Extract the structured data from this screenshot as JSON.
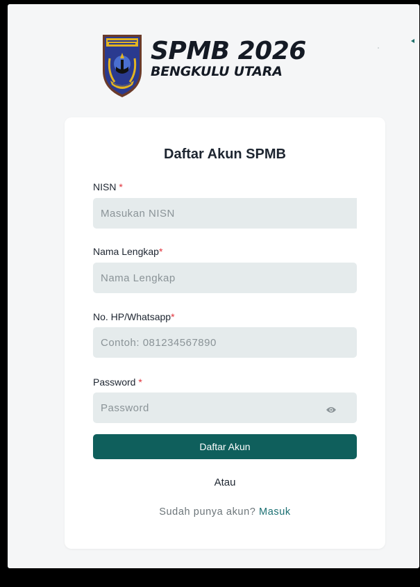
{
  "brand": {
    "title": "SPMB 2026",
    "subtitle": "BENGKULU UTARA",
    "crest_icon": "kabupaten-crest-icon",
    "crest_colors": {
      "shield": "#2a3a8f",
      "gold": "#e3b422",
      "border": "#6b3b2a"
    }
  },
  "form": {
    "title": "Daftar Akun SPMB",
    "fields": [
      {
        "label": "NISN ",
        "required_mark": "*",
        "placeholder": "Masukan NISN",
        "value": ""
      },
      {
        "label": "Nama Lengkap",
        "required_mark": "*",
        "placeholder": "Nama Lengkap",
        "value": ""
      },
      {
        "label": "No. HP/Whatsapp",
        "required_mark": "*",
        "placeholder": "Contoh: 081234567890",
        "value": ""
      },
      {
        "label": "Password ",
        "required_mark": "*",
        "placeholder": "Password",
        "value": ""
      }
    ],
    "password_toggle_icon": "eye-icon",
    "submit_label": "Daftar Akun",
    "separator": "Atau",
    "login_prompt": "Sudah punya akun? ",
    "login_link": "Masuk"
  },
  "colors": {
    "primary": "#0f5f5c",
    "required": "#e0313a",
    "input_bg": "#e5ebec",
    "link": "#1a6f72"
  }
}
